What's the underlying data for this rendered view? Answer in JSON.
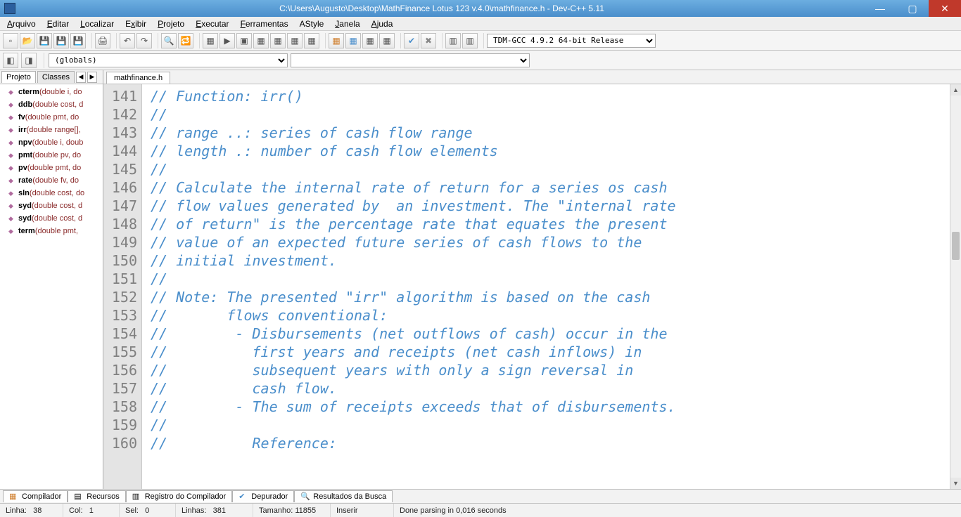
{
  "window": {
    "title": "C:\\Users\\Augusto\\Desktop\\MathFinance Lotus 123 v.4.0\\mathfinance.h - Dev-C++ 5.11"
  },
  "menus": [
    "Arquivo",
    "Editar",
    "Localizar",
    "Exibir",
    "Projeto",
    "Executar",
    "Ferramentas",
    "AStyle",
    "Janela",
    "Ajuda"
  ],
  "compiler_selector": "TDM-GCC 4.9.2 64-bit Release",
  "scope_selector": "(globals)",
  "left_tabs": {
    "projeto": "Projeto",
    "classes": "Classes"
  },
  "class_items": [
    {
      "name": "cterm",
      "sig": "(double i, do"
    },
    {
      "name": "ddb",
      "sig": "(double cost, d"
    },
    {
      "name": "fv",
      "sig": "(double pmt, do"
    },
    {
      "name": "irr",
      "sig": "(double range[],"
    },
    {
      "name": "npv",
      "sig": "(double i, doub"
    },
    {
      "name": "pmt",
      "sig": "(double pv, do"
    },
    {
      "name": "pv",
      "sig": "(double pmt, do"
    },
    {
      "name": "rate",
      "sig": "(double fv, do"
    },
    {
      "name": "sln",
      "sig": "(double cost, do"
    },
    {
      "name": "syd",
      "sig": "(double cost, d"
    },
    {
      "name": "syd",
      "sig": "(double cost, d"
    },
    {
      "name": "term",
      "sig": "(double pmt,"
    }
  ],
  "editor": {
    "tab": "mathfinance.h",
    "first_line": 141,
    "lines": [
      "// Function: irr()",
      "//",
      "// range ..: series of cash flow range",
      "// length .: number of cash flow elements",
      "//",
      "// Calculate the internal rate of return for a series os cash",
      "// flow values generated by  an investment. The \"internal rate",
      "// of return\" is the percentage rate that equates the present",
      "// value of an expected future series of cash flows to the",
      "// initial investment.",
      "//",
      "// Note: The presented \"irr\" algorithm is based on the cash",
      "//       flows conventional:",
      "//        - Disbursements (net outflows of cash) occur in the",
      "//          first years and receipts (net cash inflows) in",
      "//          subsequent years with only a sign reversal in",
      "//          cash flow.",
      "//        - The sum of receipts exceeds that of disbursements.",
      "//",
      "//          Reference:"
    ]
  },
  "bottom_tabs": [
    "Compilador",
    "Recursos",
    "Registro do Compilador",
    "Depurador",
    "Resultados da Busca"
  ],
  "status": {
    "linha": "Linha:   38",
    "col": "Col:   1",
    "sel": "Sel:   0",
    "linhas": "Linhas:   381",
    "tamanho": "Tamanho: 11855",
    "modo": "Inserir",
    "parse": "Done parsing in 0,016 seconds"
  }
}
